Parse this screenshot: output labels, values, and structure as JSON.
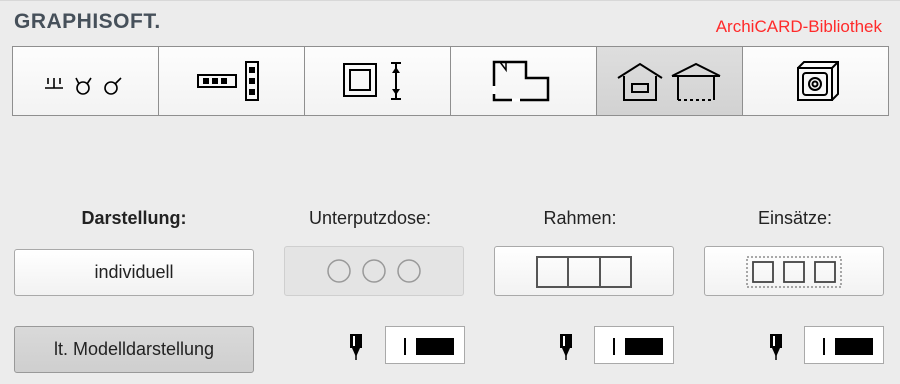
{
  "header": {
    "brand": "GRAPHISOFT.",
    "library": "ArchiCARD-Bibliothek",
    "library_color": "#ff2a2a"
  },
  "tabs": [
    {
      "icon": "sockets-icon",
      "active": false
    },
    {
      "icon": "switch-strip-icon",
      "active": false
    },
    {
      "icon": "frame-height-icon",
      "active": false
    },
    {
      "icon": "floor-plan-icon",
      "active": false
    },
    {
      "icon": "house-garage-icon",
      "active": true
    },
    {
      "icon": "3d-view-icon",
      "active": false
    }
  ],
  "settings": {
    "darstellung_label": "Darstellung:",
    "unterputzdose_label": "Unterputzdose:",
    "rahmen_label": "Rahmen:",
    "einsaetze_label": "Einsätze:",
    "individuell_button": "individuell",
    "modell_button": "lt. Modelldarstellung"
  },
  "colors": {
    "background": "#ececec",
    "active_tab": "#d6d6d6",
    "pen_swatch": "#000000"
  }
}
